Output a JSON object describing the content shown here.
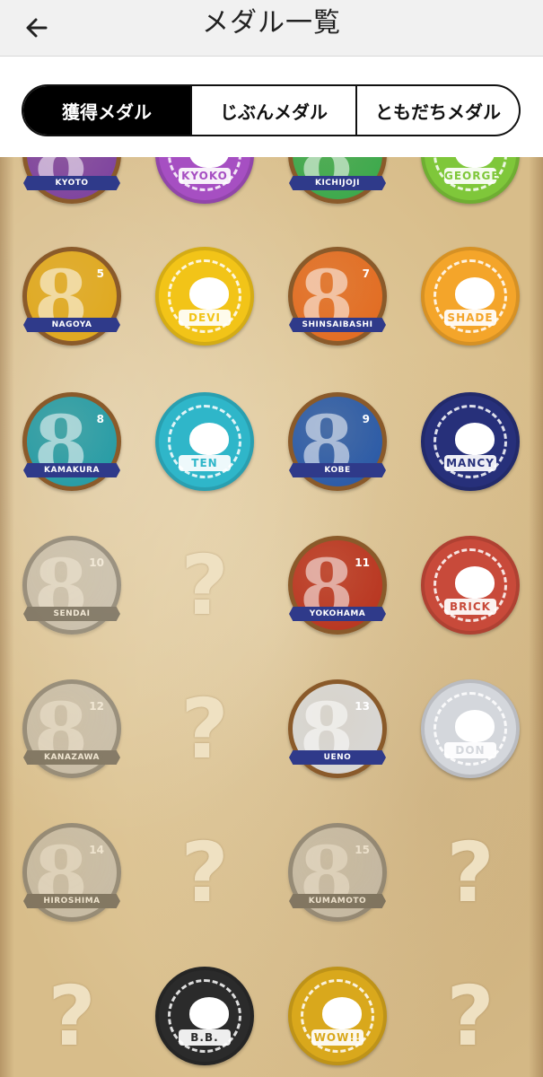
{
  "header": {
    "title": "メダル一覧",
    "back_icon": "arrow-left-icon"
  },
  "tabs": [
    {
      "label": "獲得メダル",
      "active": true
    },
    {
      "label": "じぶんメダル",
      "active": false
    },
    {
      "label": "ともだちメダル",
      "active": false
    }
  ],
  "medals": [
    {
      "label": "KYOTO",
      "kind": "city",
      "color": "#7b3fa0",
      "state": "earned"
    },
    {
      "label": "KYOKO",
      "kind": "cat",
      "color": "#a64fc2",
      "state": "earned"
    },
    {
      "label": "KICHIJOJI",
      "kind": "city",
      "color": "#36a84a",
      "state": "earned"
    },
    {
      "label": "GEORGE",
      "kind": "cat",
      "color": "#7fc73a",
      "state": "earned"
    },
    {
      "label": "NAGOYA",
      "kind": "city",
      "color": "#e0a81a",
      "number": "5",
      "state": "earned"
    },
    {
      "label": "DEVI",
      "kind": "cat",
      "color": "#f2c418",
      "state": "earned"
    },
    {
      "label": "SHINSAIBASHI",
      "kind": "city",
      "color": "#e2691e",
      "number": "7",
      "state": "earned"
    },
    {
      "label": "SHADE",
      "kind": "cat",
      "color": "#f4a52a",
      "state": "earned"
    },
    {
      "label": "KAMAKURA",
      "kind": "city",
      "color": "#1f9aa6",
      "number": "8",
      "state": "earned"
    },
    {
      "label": "TEN",
      "kind": "cat",
      "color": "#2fb6c9",
      "state": "earned"
    },
    {
      "label": "KOBE",
      "kind": "city",
      "color": "#2356a8",
      "number": "9",
      "state": "earned"
    },
    {
      "label": "MANCY",
      "kind": "cat",
      "color": "#27307a",
      "state": "earned"
    },
    {
      "label": "SENDAI",
      "kind": "city",
      "color": "#b8b8b8",
      "number": "10",
      "state": "locked"
    },
    {
      "label": "",
      "kind": "unknown",
      "state": "unknown"
    },
    {
      "label": "YOKOHAMA",
      "kind": "city",
      "color": "#b8301c",
      "number": "11",
      "state": "earned"
    },
    {
      "label": "BRICK",
      "kind": "cat",
      "color": "#c84a3a",
      "state": "earned"
    },
    {
      "label": "KANAZAWA",
      "kind": "city",
      "color": "#b8b8b8",
      "number": "12",
      "state": "locked"
    },
    {
      "label": "",
      "kind": "unknown",
      "state": "unknown"
    },
    {
      "label": "UENO",
      "kind": "city",
      "color": "#d8d8d8",
      "number": "13",
      "state": "earned"
    },
    {
      "label": "DON",
      "kind": "cat",
      "color": "#d4d7dc",
      "state": "earned"
    },
    {
      "label": "HIROSHIMA",
      "kind": "city",
      "color": "#b8b8b8",
      "number": "14",
      "state": "locked"
    },
    {
      "label": "",
      "kind": "unknown",
      "state": "unknown"
    },
    {
      "label": "KUMAMOTO",
      "kind": "city",
      "color": "#b8b8b8",
      "number": "15",
      "state": "locked"
    },
    {
      "label": "",
      "kind": "unknown",
      "state": "unknown"
    },
    {
      "label": "",
      "kind": "unknown",
      "state": "unknown"
    },
    {
      "label": "B.B.",
      "kind": "cat",
      "color": "#2b2b2b",
      "state": "earned"
    },
    {
      "label": "WOW!!",
      "kind": "cat",
      "color": "#d9a81c",
      "state": "earned"
    },
    {
      "label": "",
      "kind": "unknown",
      "state": "unknown"
    }
  ],
  "unknown_glyph": "?"
}
